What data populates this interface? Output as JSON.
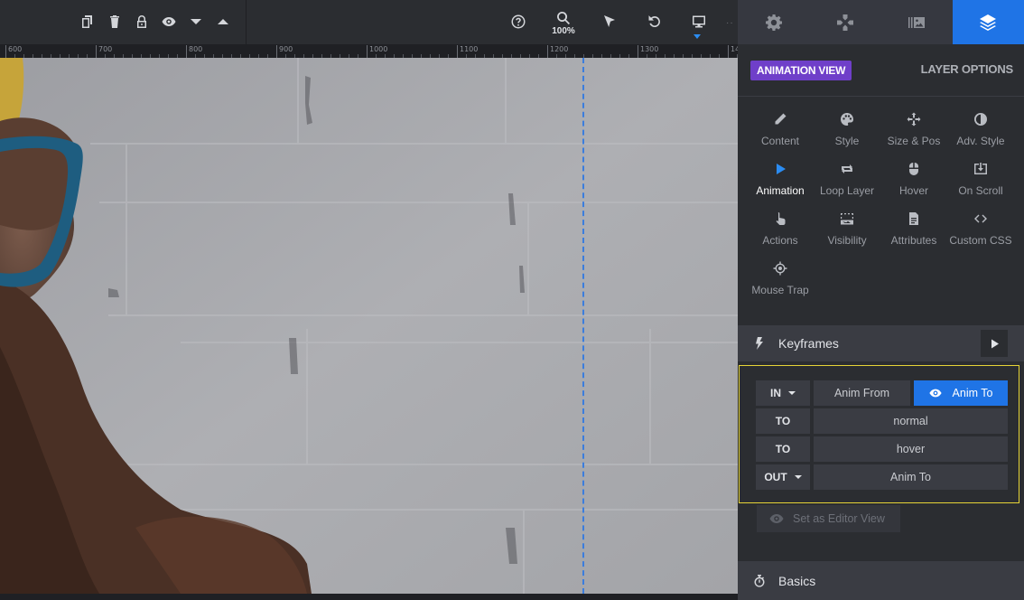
{
  "toolbar": {
    "zoom": "100%",
    "icons": [
      "copy-icon",
      "delete-icon",
      "lock-icon",
      "visibility-icon",
      "caret-down-icon",
      "caret-up-icon",
      "help-icon",
      "zoom-icon",
      "select-cursor-icon",
      "undo-icon",
      "desktop-icon"
    ]
  },
  "ruler": {
    "labels": [
      "600",
      "700",
      "800",
      "900",
      "1000",
      "1100",
      "1200",
      "1300",
      "14"
    ]
  },
  "panel": {
    "tabs": [
      "settings-icon",
      "navigation-icon",
      "media-library-icon",
      "layers-icon"
    ],
    "active_tab": "layers-icon",
    "animation_view": "ANIMATION VIEW",
    "layer_options": "LAYER OPTIONS",
    "menu": [
      {
        "label": "Content",
        "icon": "pencil-icon"
      },
      {
        "label": "Style",
        "icon": "palette-icon"
      },
      {
        "label": "Size & Pos",
        "icon": "move-icon"
      },
      {
        "label": "Adv. Style",
        "icon": "contrast-icon"
      },
      {
        "label": "Animation",
        "icon": "play-icon",
        "active": true
      },
      {
        "label": "Loop Layer",
        "icon": "loop-icon"
      },
      {
        "label": "Hover",
        "icon": "mouse-icon"
      },
      {
        "label": "On Scroll",
        "icon": "scroll-download-icon"
      },
      {
        "label": "Actions",
        "icon": "pointer-hand-icon"
      },
      {
        "label": "Visibility",
        "icon": "visibility-icon"
      },
      {
        "label": "Attributes",
        "icon": "document-icon"
      },
      {
        "label": "Custom CSS",
        "icon": "code-icon"
      },
      {
        "label": "Mouse Trap",
        "icon": "crosshair-icon"
      }
    ],
    "keyframes": {
      "title": "Keyframes",
      "rows": [
        {
          "type": "IN",
          "dropdown": true,
          "cells": [
            {
              "label": "Anim From"
            },
            {
              "label": "Anim To",
              "active": true
            }
          ]
        },
        {
          "type": "TO",
          "dropdown": false,
          "cells": [
            {
              "label": "normal"
            }
          ]
        },
        {
          "type": "TO",
          "dropdown": false,
          "cells": [
            {
              "label": "hover"
            }
          ]
        },
        {
          "type": "OUT",
          "dropdown": true,
          "cells": [
            {
              "label": "Anim To"
            }
          ]
        }
      ]
    },
    "editor_view": "Set as Editor View",
    "basics": "Basics"
  },
  "colors": {
    "accent": "#1f74e6",
    "purple": "#6f3fc9",
    "highlight_border": "#e6d437",
    "guide": "#3b7ddd"
  }
}
